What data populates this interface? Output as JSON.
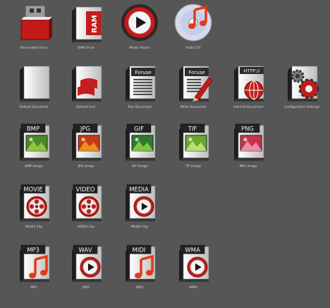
{
  "icons": [
    {
      "caption": "Removable Drive",
      "kind": "usb",
      "icon": "usb-drive-icon"
    },
    {
      "caption": "RAM Drive",
      "kind": "ram",
      "tag": "RAM",
      "icon": "ram-drive-icon"
    },
    {
      "caption": "Media Player",
      "kind": "player",
      "icon": "media-player-icon"
    },
    {
      "caption": "Audio CD",
      "kind": "cd",
      "icon": "audio-cd-icon"
    },
    {
      "caption": "Default Document",
      "kind": "doc",
      "icon": "document-icon"
    },
    {
      "caption": "Default Icon",
      "kind": "winflag",
      "icon": "windows-flag-icon"
    },
    {
      "caption": "Text Document",
      "kind": "text",
      "tag": "Foruse",
      "icon": "text-document-icon"
    },
    {
      "caption": "Write Document",
      "kind": "write",
      "tag": "Foruse",
      "icon": "write-document-icon"
    },
    {
      "caption": "Internet Document",
      "kind": "http",
      "tag": "HTTP://",
      "icon": "internet-document-icon"
    },
    {
      "caption": "Configuration Settings",
      "kind": "config",
      "icon": "gears-icon"
    },
    {
      "caption": "BMP Image",
      "kind": "image",
      "tag": "BMP",
      "photo": "#4a8a2a",
      "photo2": "#9ad040",
      "icon": "bmp-image-icon"
    },
    {
      "caption": "JPG Image",
      "kind": "image",
      "tag": "JPG",
      "photo": "#c83a10",
      "photo2": "#f0a020",
      "icon": "jpg-image-icon"
    },
    {
      "caption": "GIF Image",
      "kind": "image",
      "tag": "GIF",
      "photo": "#2e7a2e",
      "photo2": "#8cd04a",
      "icon": "gif-image-icon"
    },
    {
      "caption": "TIF Image",
      "kind": "image",
      "tag": "TIF",
      "photo": "#6aa830",
      "photo2": "#c8e880",
      "icon": "tif-image-icon"
    },
    {
      "caption": "PNG Image",
      "kind": "image",
      "tag": "PNG",
      "photo": "#c8324a",
      "photo2": "#f0a0b8",
      "icon": "png-image-icon"
    },
    {
      "caption": "MOVIE Clip",
      "kind": "reel",
      "tag": "MOVIE",
      "icon": "movie-clip-icon"
    },
    {
      "caption": "VIDEO Clip",
      "kind": "reel",
      "tag": "VIDEO",
      "icon": "video-clip-icon"
    },
    {
      "caption": "MEDIA Clip",
      "kind": "playdoc",
      "tag": "MEDIA",
      "icon": "media-clip-icon"
    },
    {
      "caption": "MP3",
      "kind": "note",
      "tag": "MP3",
      "icon": "mp3-icon"
    },
    {
      "caption": "WAV",
      "kind": "playdoc",
      "tag": "WAV",
      "icon": "wav-icon"
    },
    {
      "caption": "MIDI",
      "kind": "note",
      "tag": "MIDI",
      "icon": "midi-icon"
    },
    {
      "caption": "WMA",
      "kind": "playdoc",
      "tag": "WMA",
      "icon": "wma-icon"
    }
  ]
}
